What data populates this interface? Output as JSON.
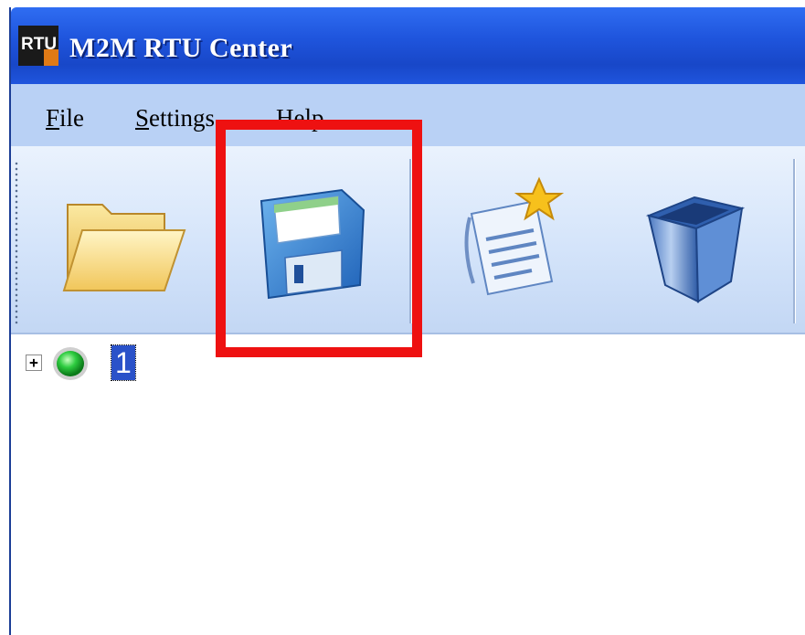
{
  "window": {
    "title": "M2M RTU Center",
    "logo_text": "RTU"
  },
  "menu": {
    "items": [
      {
        "mnemonic": "F",
        "rest": "ile"
      },
      {
        "mnemonic": "S",
        "rest": "ettings"
      },
      {
        "mnemonic": "H",
        "rest": "elp"
      }
    ]
  },
  "toolbar": {
    "buttons": [
      {
        "icon": "open-folder-icon"
      },
      {
        "icon": "floppy-disk-save-icon"
      },
      {
        "icon": "new-document-star-icon"
      },
      {
        "icon": "trash-bin-icon"
      }
    ],
    "highlighted_button": "floppy-disk-save-icon"
  },
  "tree": {
    "expander_symbol": "+",
    "nodes": [
      {
        "label": "1",
        "status_color": "#2ecc40",
        "selected": true
      }
    ]
  },
  "colors": {
    "titlebar": "#1f55dd",
    "menubar": "#b9d1f5",
    "highlight": "#ee1111",
    "selection": "#2a52c9"
  }
}
